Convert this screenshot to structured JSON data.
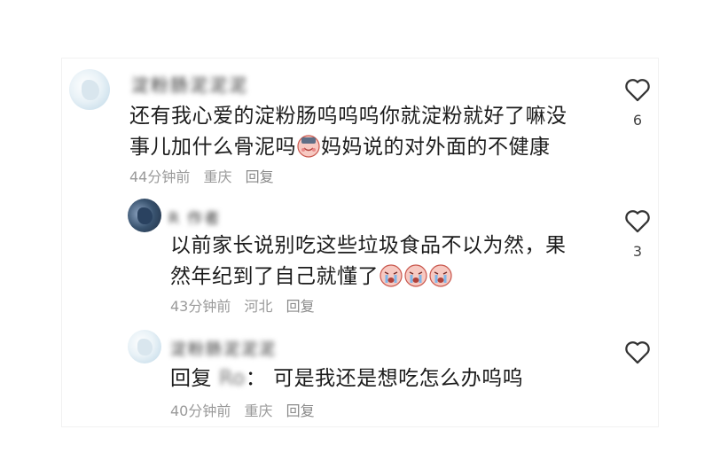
{
  "comments": [
    {
      "username": "淀粉肠泥泥泥",
      "text_line1": "还有我心爱的淀粉肠呜呜呜你就淀粉就好了嘛没",
      "text_line2_pre": "事儿加什么骨泥吗",
      "text_line2_post": "妈妈说的对外面的不健康",
      "time": "44分钟前",
      "location": "重庆",
      "reply_label": "回复",
      "likes": "6"
    },
    {
      "username": "R 作者",
      "text_line1": "以前家长说别吃这些垃圾食品不以为然，果",
      "text_line2": "然年纪到了自己就懂了",
      "time": "43分钟前",
      "location": "河北",
      "reply_label": "回复",
      "likes": "3"
    },
    {
      "username": "淀粉肠泥泥泥",
      "reply_prefix": "回复",
      "reply_to": "Ro",
      "text": "：  可是我还是想吃怎么办呜呜",
      "time": "40分钟前",
      "location": "重庆",
      "reply_label": "回复"
    }
  ],
  "icons": {
    "heart": "heart-outline-icon",
    "crying": "crying-face-emoji",
    "blushing": "blushing-face-emoji"
  },
  "colors": {
    "meta": "#9a9a9a",
    "heart": "#333333",
    "emoji_face": "#f7c9c2",
    "emoji_tear": "#7fb6e8"
  }
}
